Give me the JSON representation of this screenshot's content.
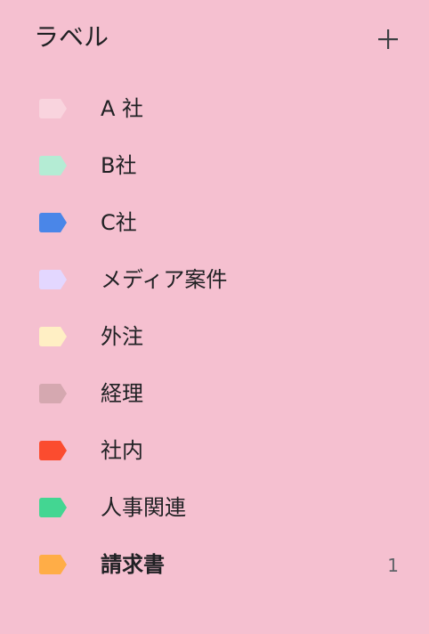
{
  "panel": {
    "title": "ラベル",
    "add_icon": "plus-icon"
  },
  "labels": [
    {
      "name": "A 社",
      "color": "#f9d4de",
      "count": "",
      "bold": false
    },
    {
      "name": "B社",
      "color": "#b4ecd4",
      "count": "",
      "bold": false
    },
    {
      "name": "C社",
      "color": "#4a86e8",
      "count": "",
      "bold": false
    },
    {
      "name": "メディア案件",
      "color": "#e3d7ff",
      "count": "",
      "bold": false
    },
    {
      "name": "外注",
      "color": "#ffefc4",
      "count": "",
      "bold": false
    },
    {
      "name": "経理",
      "color": "#d5a8b0",
      "count": "",
      "bold": false
    },
    {
      "name": "社内",
      "color": "#fb4c2f",
      "count": "",
      "bold": false
    },
    {
      "name": "人事関連",
      "color": "#43d692",
      "count": "",
      "bold": false
    },
    {
      "name": "請求書",
      "color": "#ffad47",
      "count": "1",
      "bold": true
    }
  ]
}
